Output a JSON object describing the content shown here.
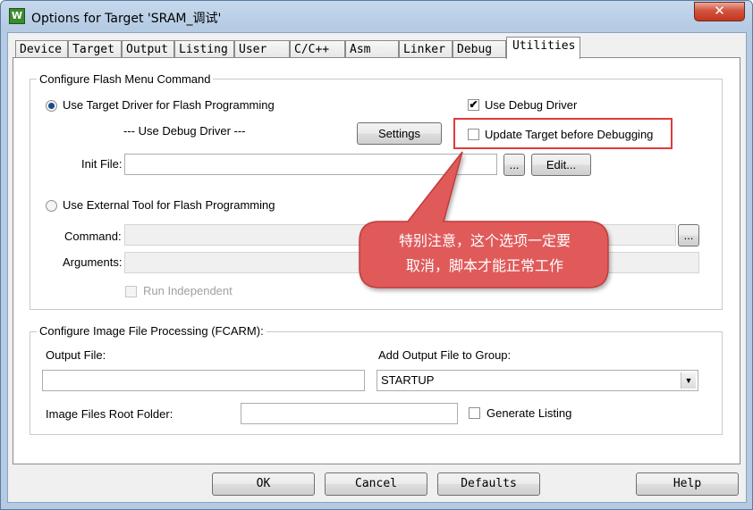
{
  "window": {
    "title": "Options for Target 'SRAM_调试'",
    "app_icon": "keil-uvision-icon",
    "app_icon_glyph": "W",
    "close_glyph": "✕"
  },
  "tabs": [
    {
      "label": "Device"
    },
    {
      "label": "Target"
    },
    {
      "label": "Output"
    },
    {
      "label": "Listing"
    },
    {
      "label": "User"
    },
    {
      "label": "C/C++"
    },
    {
      "label": "Asm"
    },
    {
      "label": "Linker"
    },
    {
      "label": "Debug"
    },
    {
      "label": "Utilities"
    }
  ],
  "flash": {
    "group_title": "Configure Flash Menu Command",
    "use_target_driver_label": "Use Target Driver for Flash Programming",
    "use_target_driver_selected": true,
    "use_debug_driver_label": "Use Debug Driver",
    "use_debug_driver_checked": true,
    "driver_text": "--- Use Debug Driver ---",
    "settings_button": "Settings",
    "update_target_label": "Update Target before Debugging",
    "update_target_checked": false,
    "init_file_label": "Init File:",
    "init_file_value": "",
    "browse_button": "...",
    "edit_button": "Edit...",
    "use_external_label": "Use External Tool for Flash Programming",
    "use_external_selected": false,
    "command_label": "Command:",
    "command_value": "",
    "command_browse": "...",
    "arguments_label": "Arguments:",
    "arguments_value": "",
    "run_independent_label": "Run Independent",
    "run_independent_checked": false
  },
  "image": {
    "group_title": "Configure Image File Processing (FCARM):",
    "output_file_label": "Output File:",
    "output_file_value": "",
    "add_output_label": "Add Output File  to Group:",
    "group_select_value": "STARTUP",
    "root_folder_label": "Image Files Root Folder:",
    "root_folder_value": "",
    "generate_listing_label": "Generate Listing",
    "generate_listing_checked": false
  },
  "annotation": {
    "line1": "特别注意，这个选项一定要",
    "line2": "取消，脚本才能正常工作",
    "color": "#e05a5a"
  },
  "footer": {
    "ok": "OK",
    "cancel": "Cancel",
    "defaults": "Defaults",
    "help": "Help"
  },
  "colors": {
    "highlight_border": "#e03b3b",
    "radio_dot": "#1b4a8a"
  }
}
